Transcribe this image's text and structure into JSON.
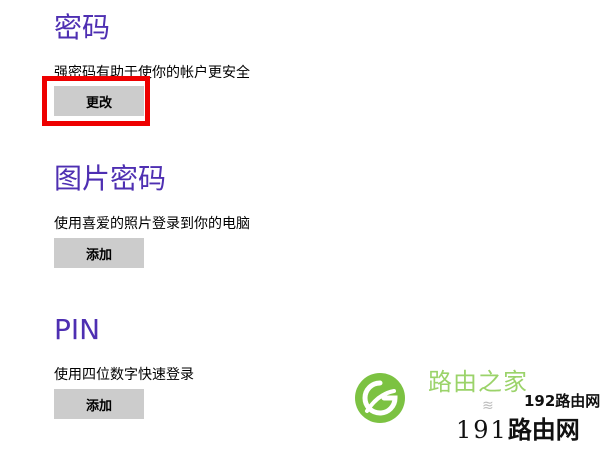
{
  "password": {
    "heading": "密码",
    "description": "强密码有助于使你的帐户更安全",
    "button": "更改"
  },
  "picture_password": {
    "heading": "图片密码",
    "description": "使用喜爱的照片登录到你的电脑",
    "button": "添加"
  },
  "pin": {
    "heading": "PIN",
    "description": "使用四位数字快速登录",
    "button": "添加"
  },
  "watermark": {
    "title": "路由之家",
    "small": "192路由网",
    "url_number": "191",
    "url_text": "路由网",
    "logo_icon": "router-home-logo-icon",
    "logo_color": "#7cc242"
  },
  "colors": {
    "heading": "#4e2fb2",
    "button_bg": "#cccccc",
    "highlight": "#ee0000"
  }
}
